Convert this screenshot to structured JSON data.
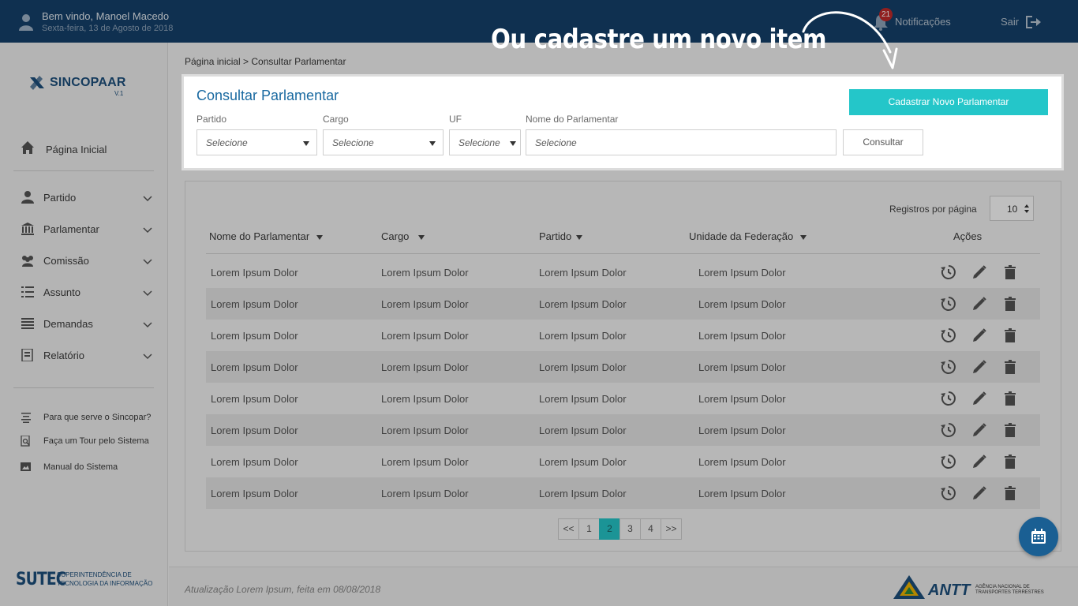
{
  "header": {
    "welcome": "Bem vindo, Manoel Macedo",
    "date": "Sexta-feira, 13 de Agosto de 2018",
    "notifications_count": "21",
    "notifications_label": "Notificações",
    "logout_label": "Sair"
  },
  "sidebar": {
    "brand": "SINCOPAAR",
    "version": "V.1",
    "home": "Página Inicial",
    "items": [
      {
        "label": "Partido",
        "icon": "user-icon"
      },
      {
        "label": "Parlamentar",
        "icon": "building-icon"
      },
      {
        "label": "Comissão",
        "icon": "group-icon"
      },
      {
        "label": "Assunto",
        "icon": "list-icon"
      },
      {
        "label": "Demandas",
        "icon": "list-lines-icon"
      },
      {
        "label": "Relatório",
        "icon": "report-icon"
      }
    ],
    "help": [
      {
        "label": "Para que serve o Sincopar?",
        "icon": "align-icon"
      },
      {
        "label": "Faça um Tour pelo Sistema",
        "icon": "doc-search-icon"
      },
      {
        "label": "Manual do Sistema",
        "icon": "image-icon"
      }
    ],
    "sutec_big": "SUTEC",
    "sutec_small": "Superintendência de Tecnologia da Informação"
  },
  "breadcrumb": "Página inicial  > Consultar Parlamentar",
  "search": {
    "title": "Consultar Parlamentar",
    "new_button": "Cadastrar Novo Parlamentar",
    "consult_button": "Consultar",
    "fields": [
      {
        "label": "Partido",
        "value": "Selecione"
      },
      {
        "label": "Cargo",
        "value": "Selecione"
      },
      {
        "label": "UF",
        "value": "Selecione"
      },
      {
        "label": "Nome do Parlamentar",
        "value": "Selecione"
      }
    ]
  },
  "table": {
    "per_page_label": "Registros por página",
    "per_page_value": "10",
    "columns": [
      "Nome do Parlamentar",
      "Cargo",
      "Partido",
      "Unidade da Federação",
      "Ações"
    ],
    "rows": [
      [
        "Lorem Ipsum Dolor",
        "Lorem Ipsum Dolor",
        "Lorem Ipsum Dolor",
        "Lorem Ipsum Dolor"
      ],
      [
        "Lorem Ipsum Dolor",
        "Lorem Ipsum Dolor",
        "Lorem Ipsum Dolor",
        "Lorem Ipsum Dolor"
      ],
      [
        "Lorem Ipsum Dolor",
        "Lorem Ipsum Dolor",
        "Lorem Ipsum Dolor",
        "Lorem Ipsum Dolor"
      ],
      [
        "Lorem Ipsum Dolor",
        "Lorem Ipsum Dolor",
        "Lorem Ipsum Dolor",
        "Lorem Ipsum Dolor"
      ],
      [
        "Lorem Ipsum Dolor",
        "Lorem Ipsum Dolor",
        "Lorem Ipsum Dolor",
        "Lorem Ipsum Dolor"
      ],
      [
        "Lorem Ipsum Dolor",
        "Lorem Ipsum Dolor",
        "Lorem Ipsum Dolor",
        "Lorem Ipsum Dolor"
      ],
      [
        "Lorem Ipsum Dolor",
        "Lorem Ipsum Dolor",
        "Lorem Ipsum Dolor",
        "Lorem Ipsum Dolor"
      ],
      [
        "Lorem Ipsum Dolor",
        "Lorem Ipsum Dolor",
        "Lorem Ipsum Dolor",
        "Lorem Ipsum Dolor"
      ]
    ],
    "actions": [
      "history-icon",
      "edit-icon",
      "trash-icon"
    ]
  },
  "pagination": {
    "prev": "<<",
    "pages": [
      "1",
      "2",
      "3",
      "4"
    ],
    "current": "2",
    "next": ">>"
  },
  "footer": {
    "update_text": "Atualização Lorem Ipsum, feita em 08/08/2018",
    "agency": "ANTT",
    "agency_sub": "Agência Nacional de Transportes Terrestres"
  },
  "tour": {
    "hint": "Ou cadastre um novo item"
  },
  "colors": {
    "topbar": "#15416b",
    "accent": "#24c6c9",
    "title_blue": "#1a6aa1",
    "badge": "#c22a2a"
  }
}
